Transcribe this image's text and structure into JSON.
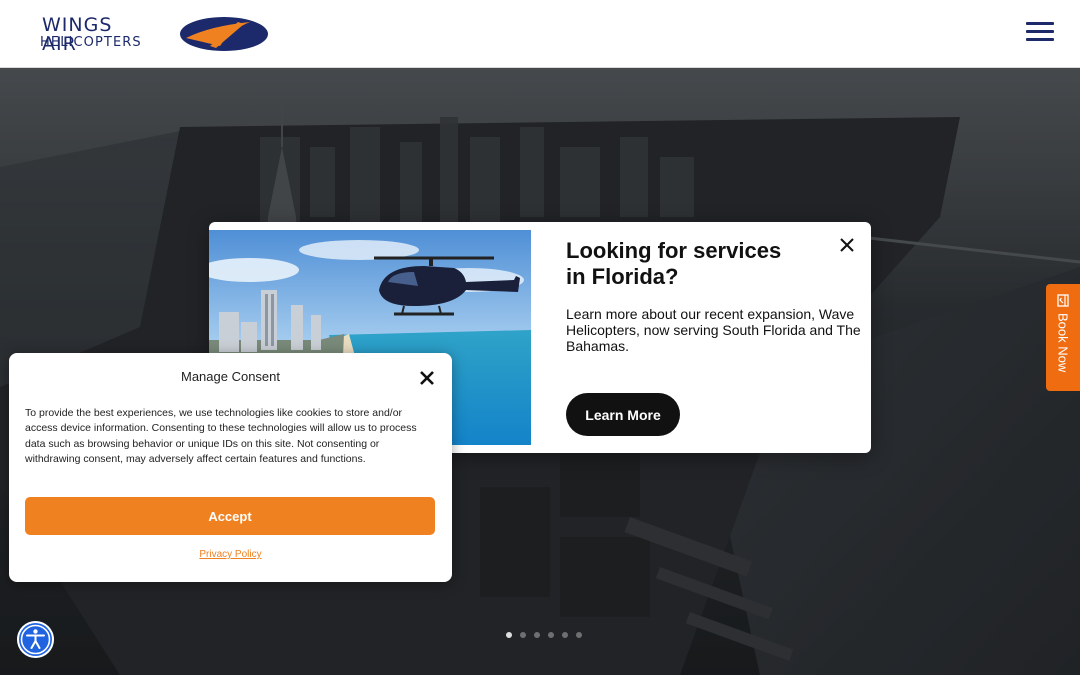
{
  "header": {
    "logo_line1": "WINGS AIR",
    "logo_line2": "HELICOPTERS",
    "brand_colors": {
      "navy": "#1c2a6b",
      "orange": "#ef8121"
    },
    "menu_icon": "hamburger-icon"
  },
  "promo": {
    "title_line1": "Looking for services",
    "title_line2": "in Florida?",
    "body": "Learn more about our recent expansion, Wave Helicopters, now serving South Florida and The Bahamas.",
    "button_label": "Learn More",
    "close_icon": "close-icon"
  },
  "consent": {
    "title": "Manage Consent",
    "body": "To provide the best experiences, we use technologies like cookies to store and/or access device information. Consenting to these technologies will allow us to process data such as browsing behavior or unique IDs on this site. Not consenting or withdrawing consent, may adversely affect certain features and functions.",
    "accept_label": "Accept",
    "privacy_label": "Privacy Policy",
    "accent_color": "#ef8121"
  },
  "book_now": {
    "label": "Book Now",
    "icon": "calendar-check-icon",
    "color": "#ef6c10"
  },
  "accessibility": {
    "icon": "accessibility-icon",
    "color": "#1f63e0"
  },
  "slider": {
    "count": 6,
    "active_index": 1
  }
}
